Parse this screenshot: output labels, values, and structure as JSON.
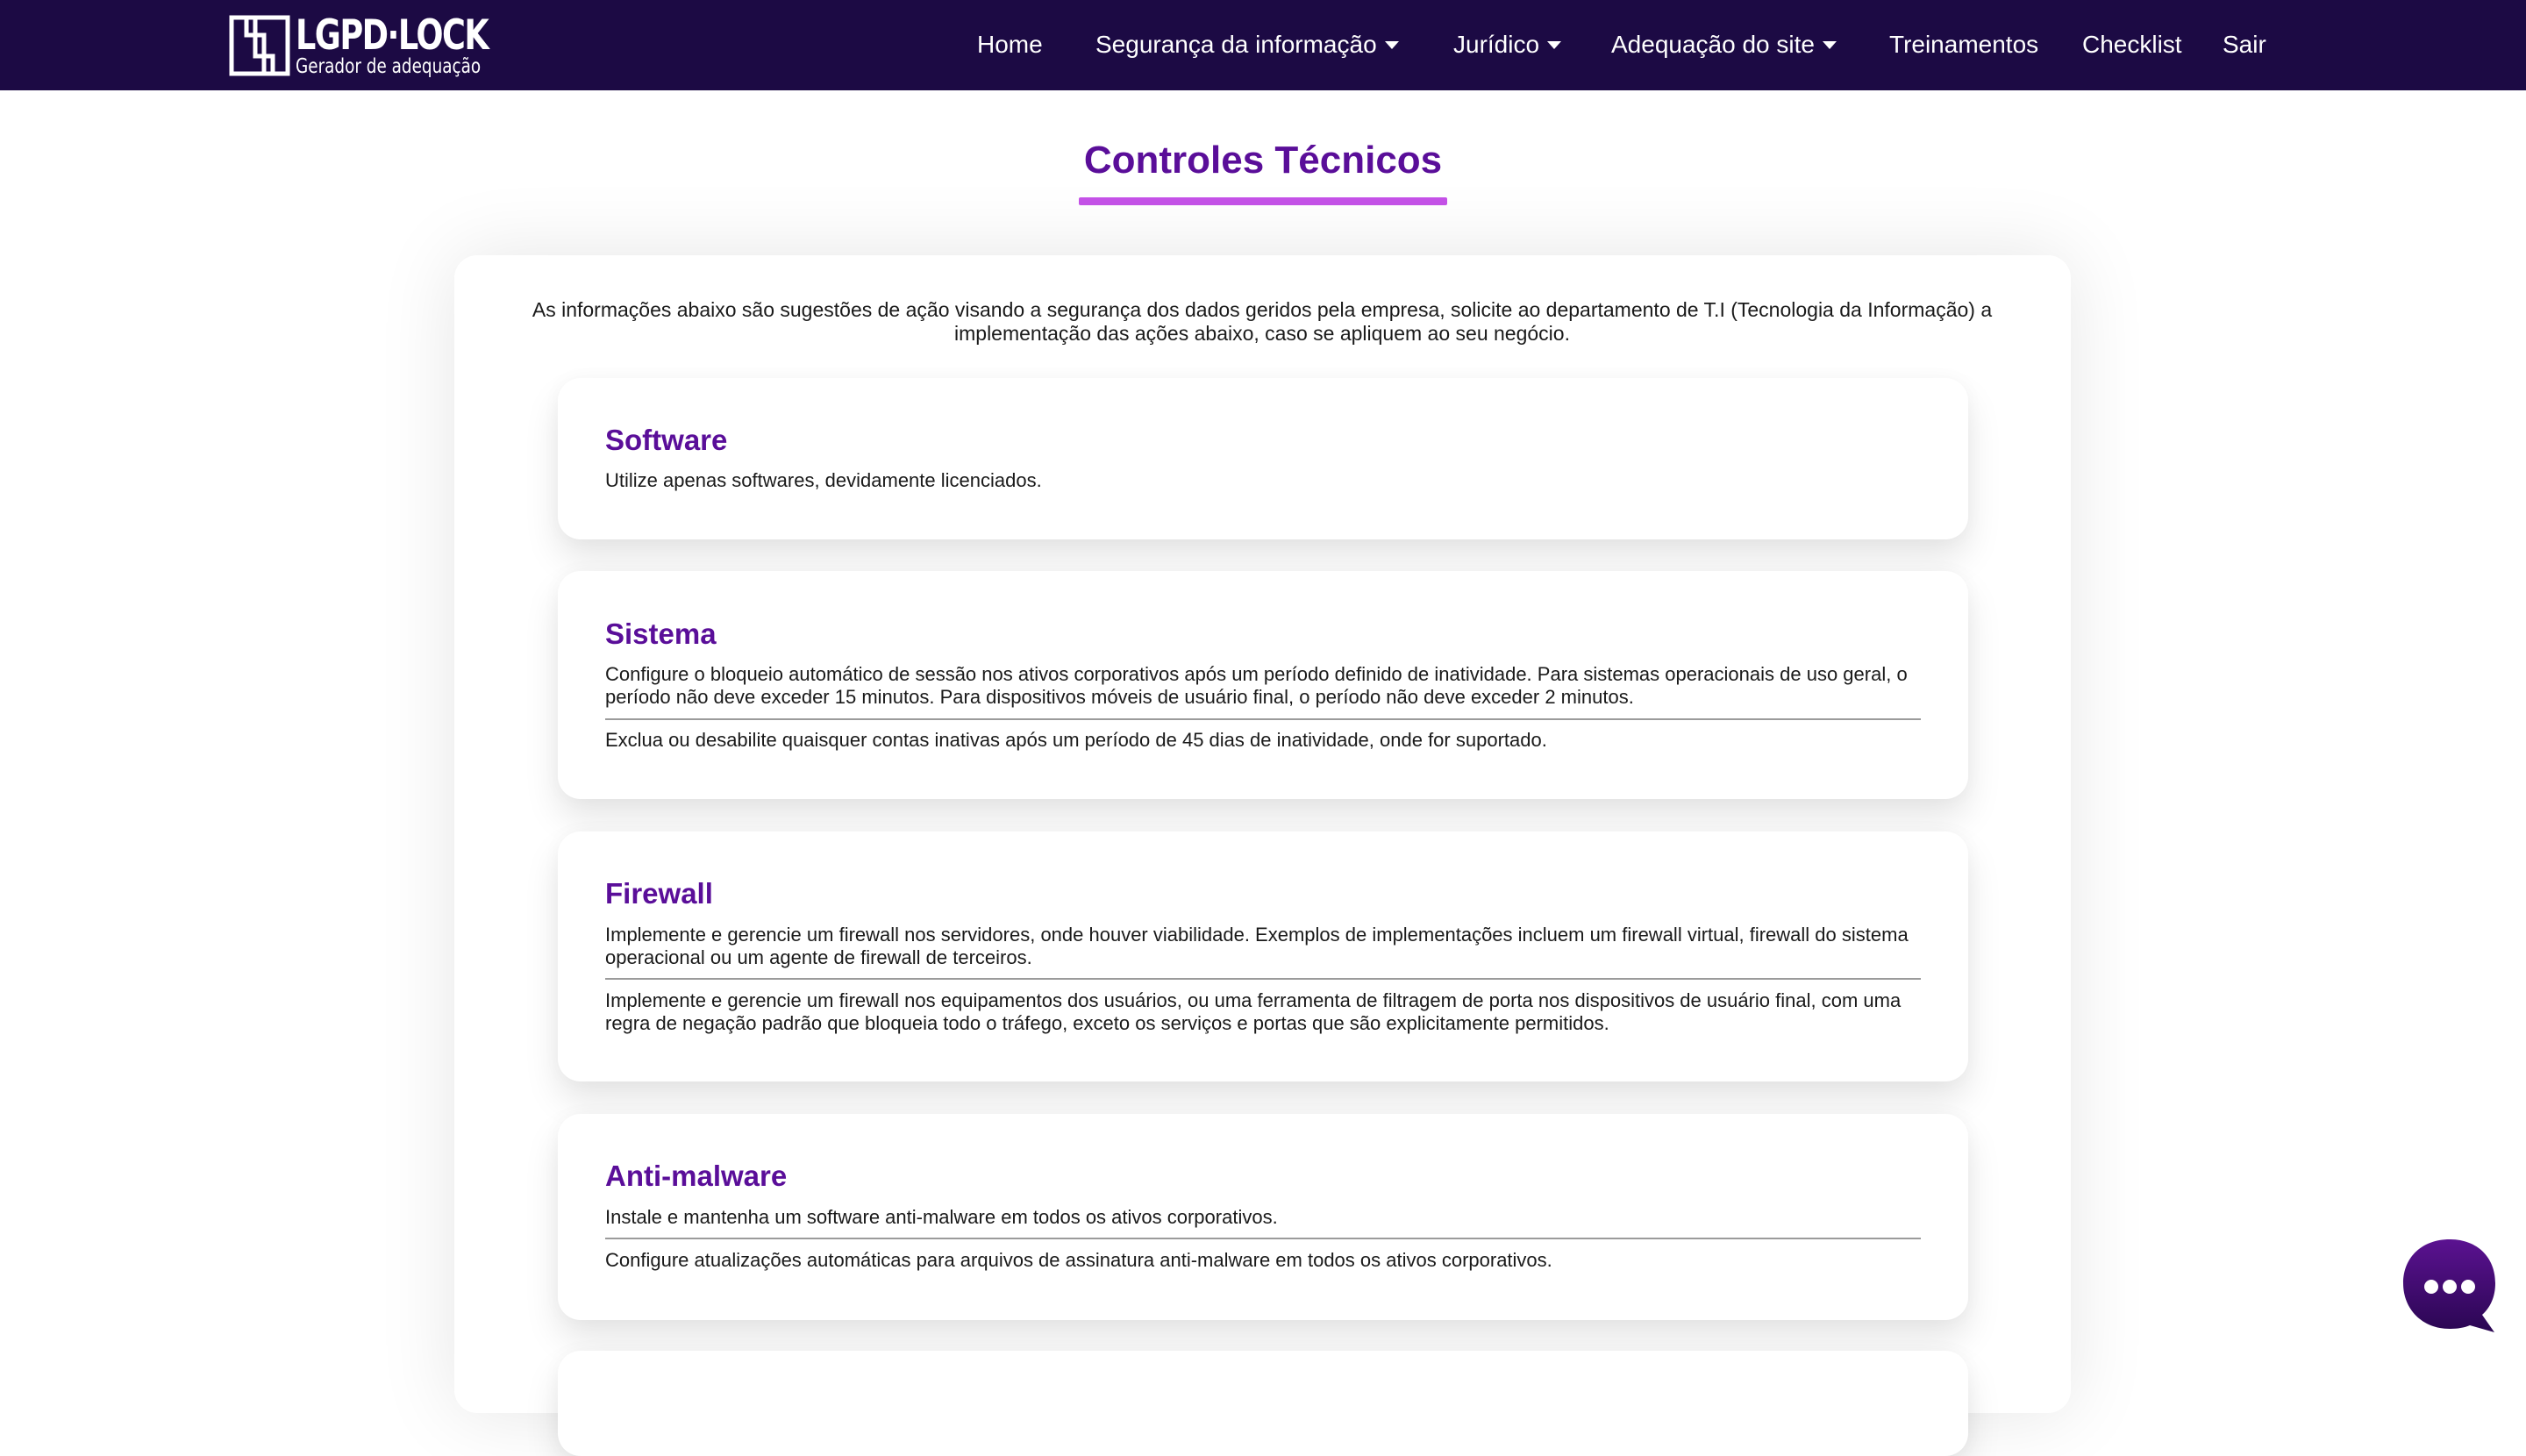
{
  "brand": {
    "title": "LGPD·LOCK",
    "subtitle": "Gerador de adequação"
  },
  "nav": {
    "home": "Home",
    "seguranca": "Segurança da informação",
    "juridico": "Jurídico",
    "adequacao": "Adequação do site",
    "treinamentos": "Treinamentos",
    "checklist": "Checklist",
    "sair": "Sair"
  },
  "page": {
    "title": "Controles Técnicos",
    "intro": "As informações abaixo são sugestões de ação visando a segurança dos dados geridos pela empresa, solicite ao departamento de T.I (Tecnologia da Informação) a implementação das ações abaixo, caso se apliquem ao seu negócio."
  },
  "sections": [
    {
      "title": "Software",
      "items": [
        "Utilize apenas softwares, devidamente licenciados."
      ]
    },
    {
      "title": "Sistema",
      "items": [
        "Configure o bloqueio automático de sessão nos ativos corporativos após um período definido de inatividade. Para sistemas operacionais de uso geral, o período não deve exceder 15 minutos. Para dispositivos móveis de usuário final, o período não deve exceder 2 minutos.",
        "Exclua ou desabilite quaisquer contas inativas após um período de 45 dias de inatividade, onde for suportado."
      ]
    },
    {
      "title": "Firewall",
      "items": [
        "Implemente e gerencie um firewall nos servidores, onde houver viabilidade. Exemplos de implementações incluem um firewall virtual, firewall do sistema operacional ou um agente de firewall de terceiros.",
        "Implemente e gerencie um firewall nos equipamentos dos usuários, ou uma ferramenta de filtragem de porta nos dispositivos de usuário final, com uma regra de negação padrão que bloqueia todo o tráfego, exceto os serviços e portas que são explicitamente permitidos."
      ]
    },
    {
      "title": "Anti-malware",
      "items": [
        "Instale e mantenha um software anti-malware em todos os ativos corporativos.",
        "Configure atualizações automáticas para arquivos de assinatura anti-malware em todos os ativos corporativos."
      ]
    }
  ],
  "colors": {
    "navbar": "#1c0a44",
    "accent": "#5a0e99",
    "underline": "#c552e8"
  },
  "icons": {
    "logo": "lgpd-lock-logo",
    "chat": "chat-bubble-icon"
  }
}
